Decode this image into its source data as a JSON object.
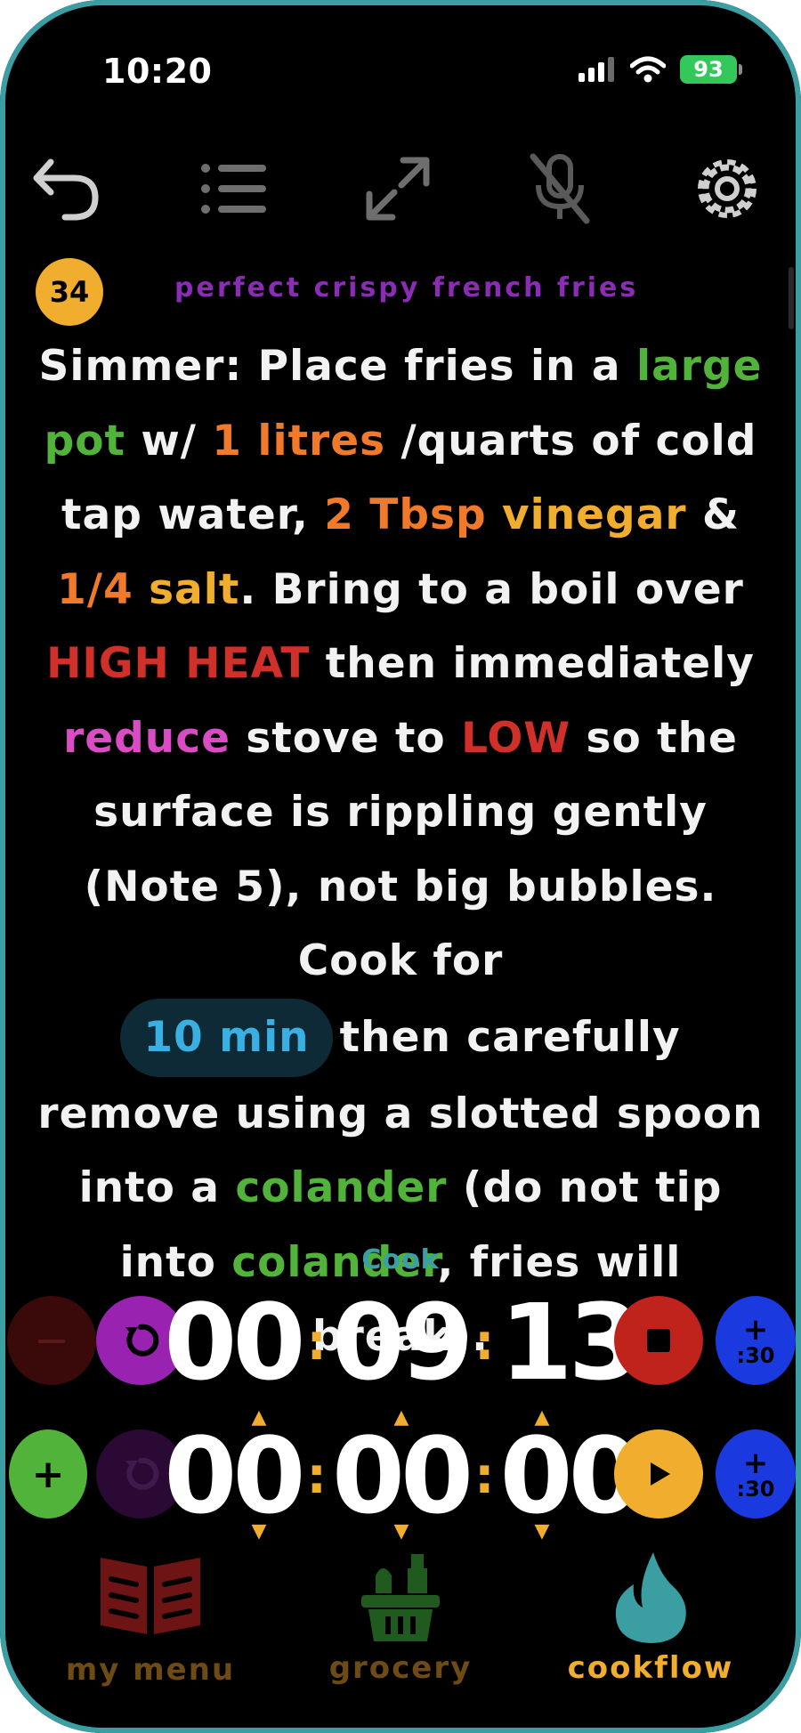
{
  "status": {
    "time": "10:20",
    "battery": "93"
  },
  "step": {
    "number": "34",
    "recipe_title": "perfect crispy french fries",
    "segments": {
      "s1": "Simmer: Place fries in a ",
      "s2": "large",
      "s3": "pot",
      "s4": " w/ ",
      "s5": "1 litres",
      "s6": " /quarts of cold tap water, ",
      "s7": "2 Tbsp",
      "s8": " ",
      "s9": "vinegar",
      "s10": " & ",
      "s11": "1/4",
      "s12": " ",
      "s13": "salt",
      "s14": ". Bring to a boil over ",
      "s15": "HIGH HEAT",
      "s16": " then immediately ",
      "s17": "reduce",
      "s18": " stove to ",
      "s19": "LOW",
      "s20": " so the surface is rippling gently (Note 5), not big bubbles. Cook for ",
      "s21": "10 min",
      "s22": "then carefully remove using a slotted spoon into a ",
      "s23": "colander",
      "s24": " (do not tip into ",
      "s25": "colander",
      "s26": ", fries will break)."
    }
  },
  "timers": {
    "label": "Cook",
    "running": {
      "hh": "00",
      "mm": "09",
      "ss": "13",
      "add_plus": "+",
      "add_label": ":30",
      "minus": "−"
    },
    "setter": {
      "hh": "00",
      "mm": "00",
      "ss": "00",
      "add_plus": "+",
      "add_label": ":30",
      "plus": "+"
    }
  },
  "nav": {
    "items": [
      {
        "label": "my menu"
      },
      {
        "label": "grocery"
      },
      {
        "label": "cookflow"
      }
    ]
  },
  "colors": {
    "accent": "#f0ad2e",
    "tool": "#52b33a",
    "quantity": "#f07a2a",
    "heat": "#d0302a",
    "action": "#d94cc4",
    "timer": "#3ab0e2",
    "frame": "#3a9ea3"
  },
  "icons": [
    "back-arrow-icon",
    "list-icon",
    "expand-icon",
    "mic-off-icon",
    "gear-icon",
    "reset-icon",
    "stop-icon",
    "play-icon",
    "book-icon",
    "basket-icon",
    "flame-icon"
  ]
}
